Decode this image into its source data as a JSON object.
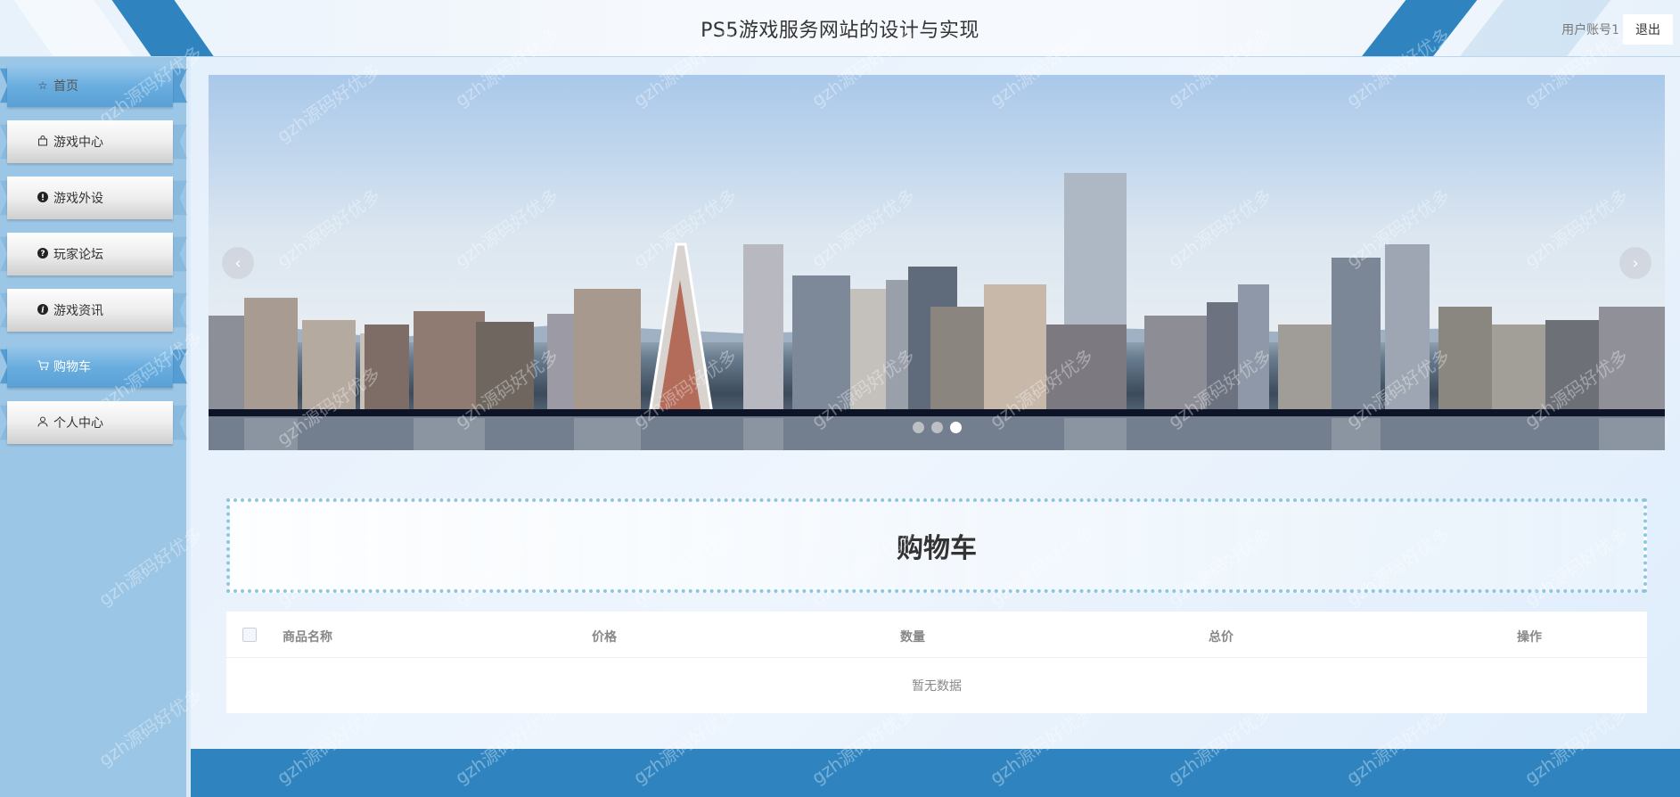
{
  "header": {
    "title": "PS5游戏服务网站的设计与实现",
    "user_account": "用户账号1",
    "logout_label": "退出"
  },
  "sidebar": {
    "items": [
      {
        "label": "首页",
        "icon": "star-icon",
        "active": true
      },
      {
        "label": "游戏中心",
        "icon": "bag-icon",
        "active": false
      },
      {
        "label": "游戏外设",
        "icon": "exclamation-icon",
        "active": false
      },
      {
        "label": "玩家论坛",
        "icon": "question-icon",
        "active": false
      },
      {
        "label": "游戏资讯",
        "icon": "info-icon",
        "active": false
      },
      {
        "label": "购物车",
        "icon": "cart-icon",
        "active": true
      },
      {
        "label": "个人中心",
        "icon": "user-icon",
        "active": false
      }
    ]
  },
  "carousel": {
    "slide_count": 3,
    "active_index": 2,
    "prev_symbol": "‹",
    "next_symbol": "›"
  },
  "cart": {
    "title": "购物车",
    "columns": [
      "商品名称",
      "价格",
      "数量",
      "总价",
      "操作"
    ],
    "empty_text": "暂无数据"
  },
  "watermark": {
    "text": "gzh源码好优多"
  },
  "colors": {
    "accent": "#2f84c0",
    "sidebar_bg": "#9cc6e5",
    "active_nav": "#6aaedf"
  }
}
